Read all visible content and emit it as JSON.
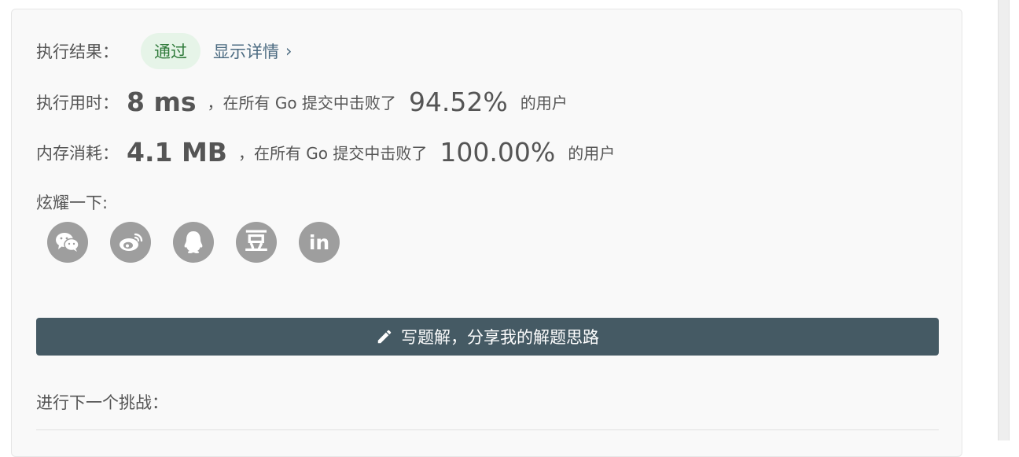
{
  "result": {
    "label": "执行结果：",
    "status": "通过",
    "details_link": "显示详情",
    "chevron": "›"
  },
  "runtime": {
    "label": "执行用时：",
    "value": "8 ms",
    "mid_text": "，在所有 Go 提交中击败了",
    "percent": "94.52%",
    "suffix": "的用户"
  },
  "memory": {
    "label": "内存消耗：",
    "value": "4.1 MB",
    "mid_text": "，在所有 Go 提交中击败了",
    "percent": "100.00%",
    "suffix": "的用户"
  },
  "share": {
    "label": "炫耀一下:",
    "icons": [
      "wechat-icon",
      "weibo-icon",
      "qq-icon",
      "douban-icon",
      "linkedin-icon"
    ],
    "douban_glyph": "豆",
    "linkedin_glyph": "in"
  },
  "solution_button": {
    "label": "写题解，分享我的解题思路",
    "icon": "pencil-icon"
  },
  "next": {
    "label": "进行下一个挑战："
  },
  "colors": {
    "card_bg": "#f9f9f9",
    "pill_bg": "#e6f4e8",
    "pill_text": "#2f7a3a",
    "link": "#4d6c82",
    "button_bg": "#455a64",
    "share_icon_bg": "#9e9e9e"
  }
}
